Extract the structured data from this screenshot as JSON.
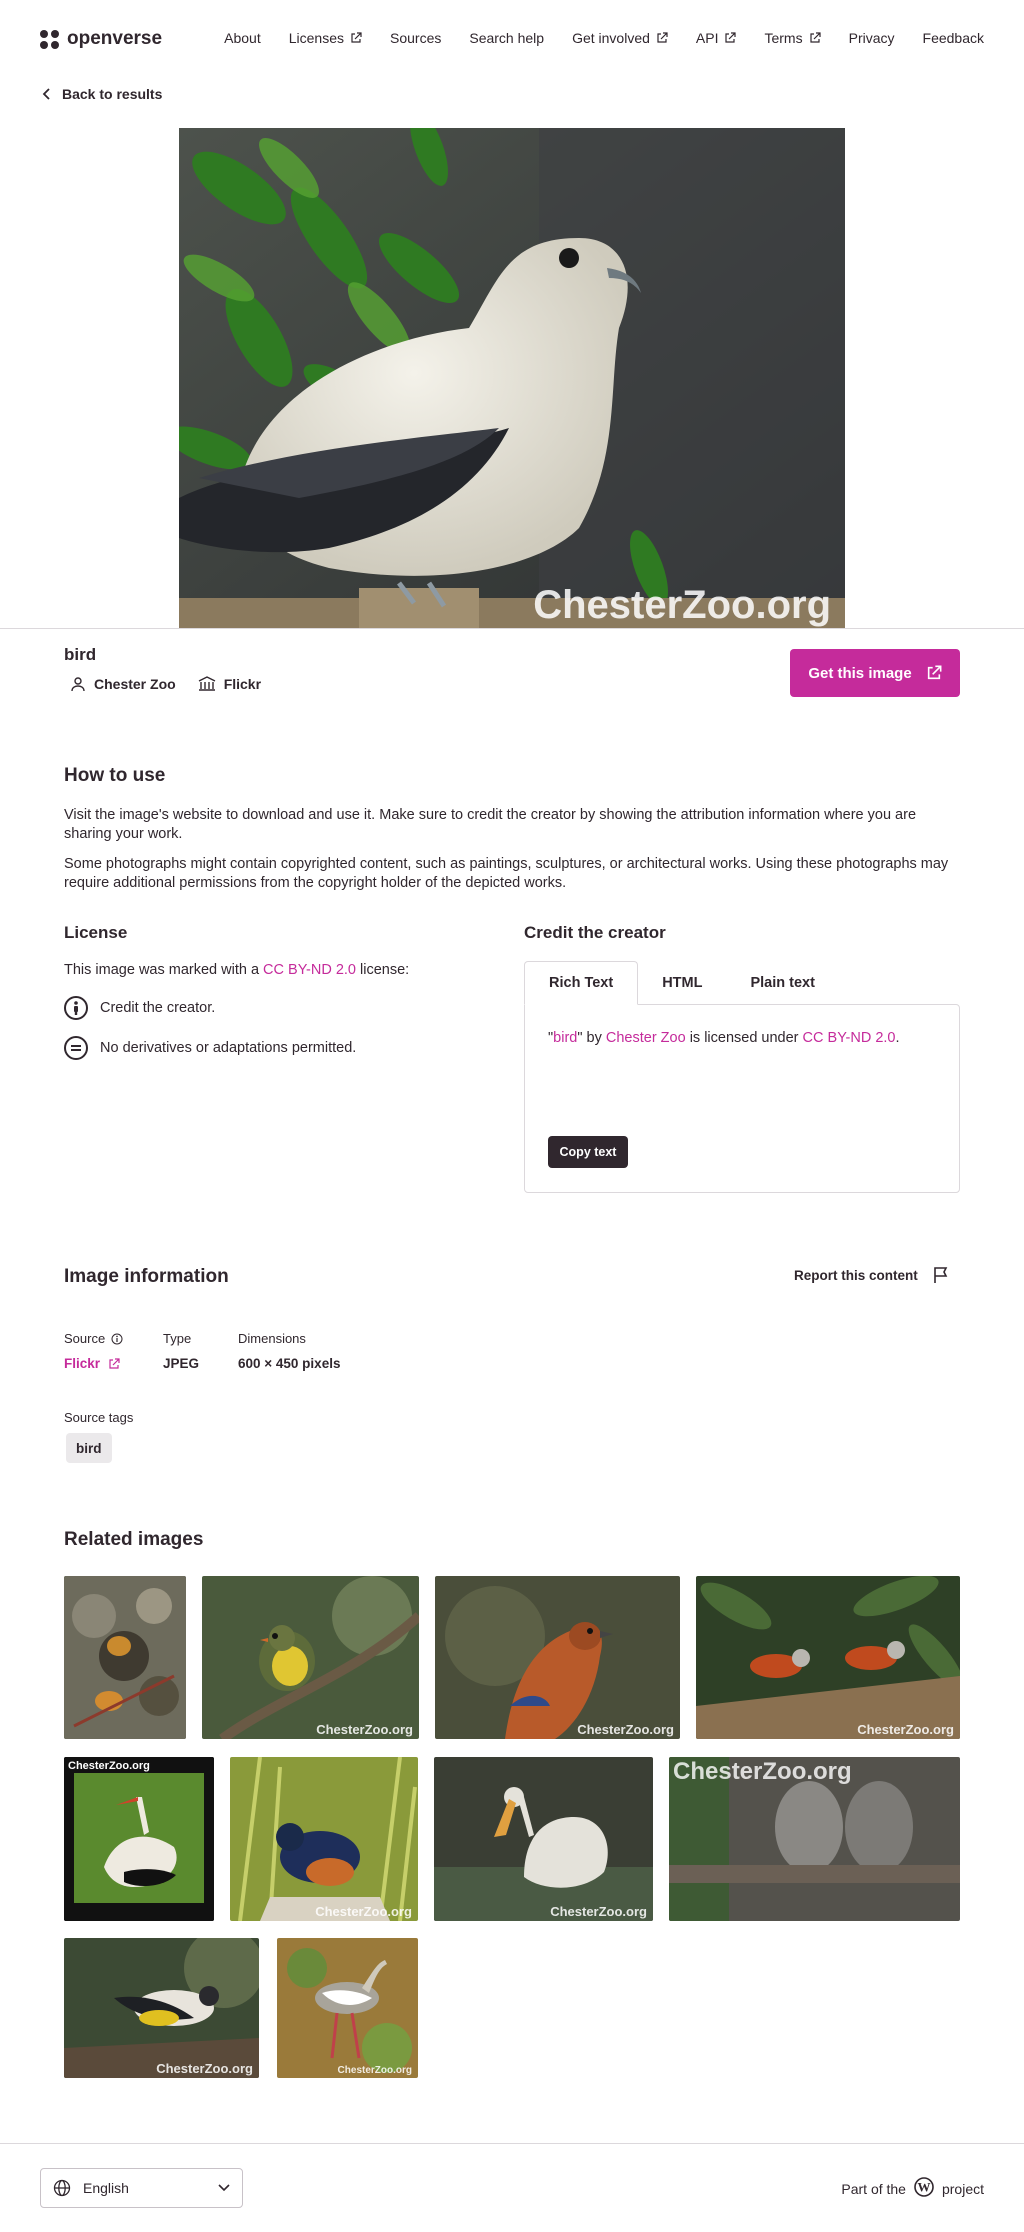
{
  "header": {
    "logo_text": "openverse",
    "nav": [
      {
        "label": "About",
        "external": false
      },
      {
        "label": "Licenses",
        "external": true
      },
      {
        "label": "Sources",
        "external": false
      },
      {
        "label": "Search help",
        "external": false
      },
      {
        "label": "Get involved",
        "external": true
      },
      {
        "label": "API",
        "external": true
      },
      {
        "label": "Terms",
        "external": true
      },
      {
        "label": "Privacy",
        "external": false
      },
      {
        "label": "Feedback",
        "external": false
      }
    ]
  },
  "back_link": "Back to results",
  "hero": {
    "watermark": "ChesterZoo.org"
  },
  "image": {
    "title": "bird",
    "creator": "Chester Zoo",
    "provider": "Flickr",
    "get_button": "Get this image"
  },
  "how_to_use": {
    "heading": "How to use",
    "p1": "Visit the image's website to download and use it. Make sure to credit the creator by showing the attribution information where you are sharing your work.",
    "p2": "Some photographs might contain copyrighted content, such as paintings, sculptures, or architectural works. Using these photographs may require additional permissions from the copyright holder of the depicted works."
  },
  "license": {
    "heading": "License",
    "text_before": "This image was marked with a ",
    "license_name": "CC BY-ND 2.0",
    "text_after": " license:",
    "items": [
      "Credit the creator.",
      "No derivatives or adaptations permitted."
    ]
  },
  "credit": {
    "heading": "Credit the creator",
    "tabs": [
      "Rich Text",
      "HTML",
      "Plain text"
    ],
    "active_tab": "Rich Text",
    "q1": "\"",
    "title_link": "bird",
    "q2": "\" by ",
    "creator_link": "Chester Zoo",
    "mid": " is licensed under ",
    "license_link": "CC BY-ND 2.0",
    "end": ".",
    "copy_button": "Copy text"
  },
  "image_info": {
    "heading": "Image information",
    "report": "Report this content",
    "source_label": "Source",
    "source_value": "Flickr",
    "type_label": "Type",
    "type_value": "JPEG",
    "dimensions_label": "Dimensions",
    "dimensions_value": "600 × 450 pixels",
    "tags_label": "Source tags",
    "tags": [
      "bird"
    ]
  },
  "related": {
    "heading": "Related images",
    "watermarks": [
      "ChesterZoo.org"
    ]
  },
  "footer": {
    "language": "English",
    "part_of": "Part of the",
    "project": "project"
  },
  "colors": {
    "accent": "#c52b9b",
    "text": "#30272e",
    "border": "#dcd8dc"
  }
}
